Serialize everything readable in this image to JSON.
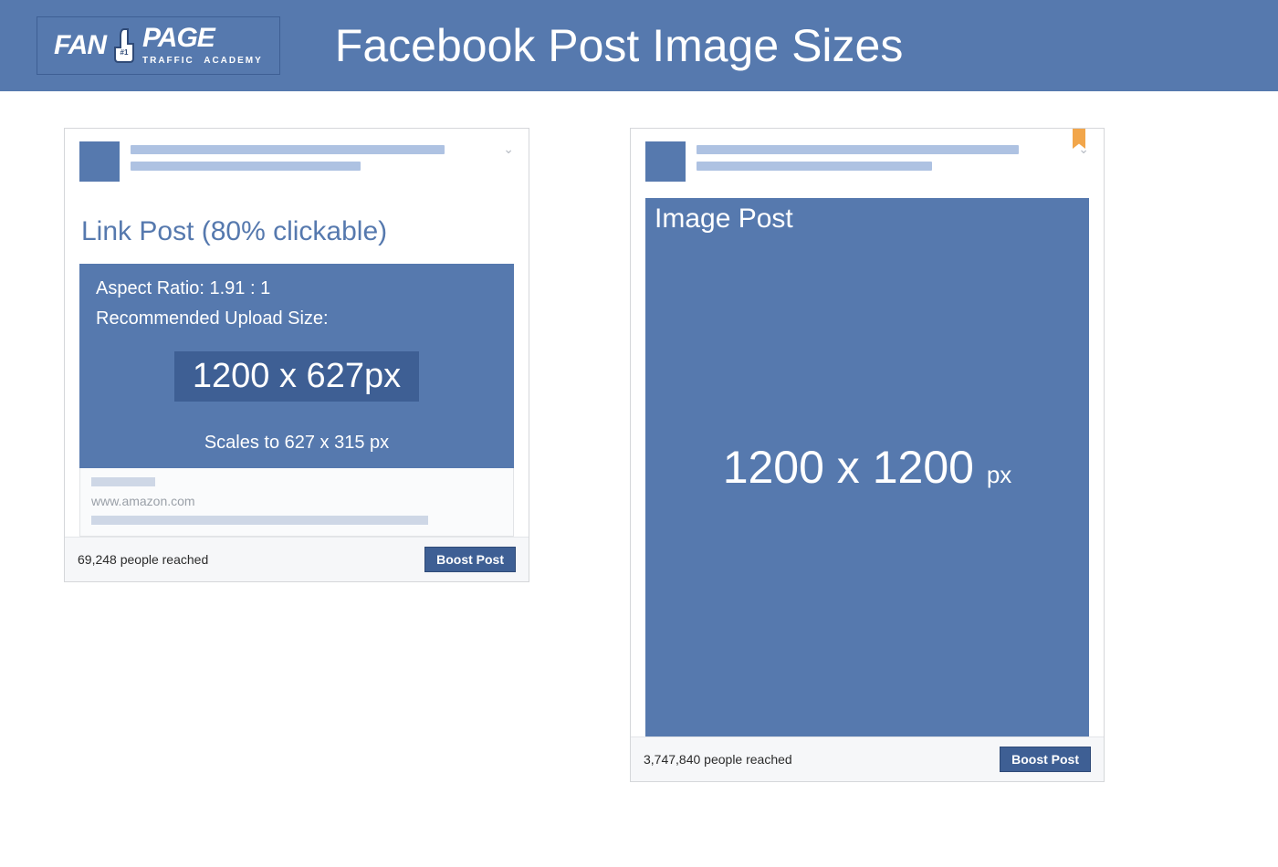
{
  "header": {
    "logo_fan": "FAN",
    "logo_page": "PAGE",
    "logo_traffic": "TRAFFIC",
    "logo_academy": "ACADEMY",
    "title": "Facebook Post Image Sizes"
  },
  "link_post": {
    "title": "Link Post (80% clickable)",
    "aspect": "Aspect Ratio: 1.91 : 1",
    "rec_label": "Recommended Upload Size:",
    "size": "1200 x 627px",
    "scales": "Scales to 627 x 315 px",
    "domain": "www.amazon.com",
    "reach": "69,248 people reached",
    "boost": "Boost Post"
  },
  "image_post": {
    "title": "Image Post",
    "size_num": "1200 x 1200",
    "size_px": "px",
    "reach": "3,747,840 people reached",
    "boost": "Boost Post"
  }
}
